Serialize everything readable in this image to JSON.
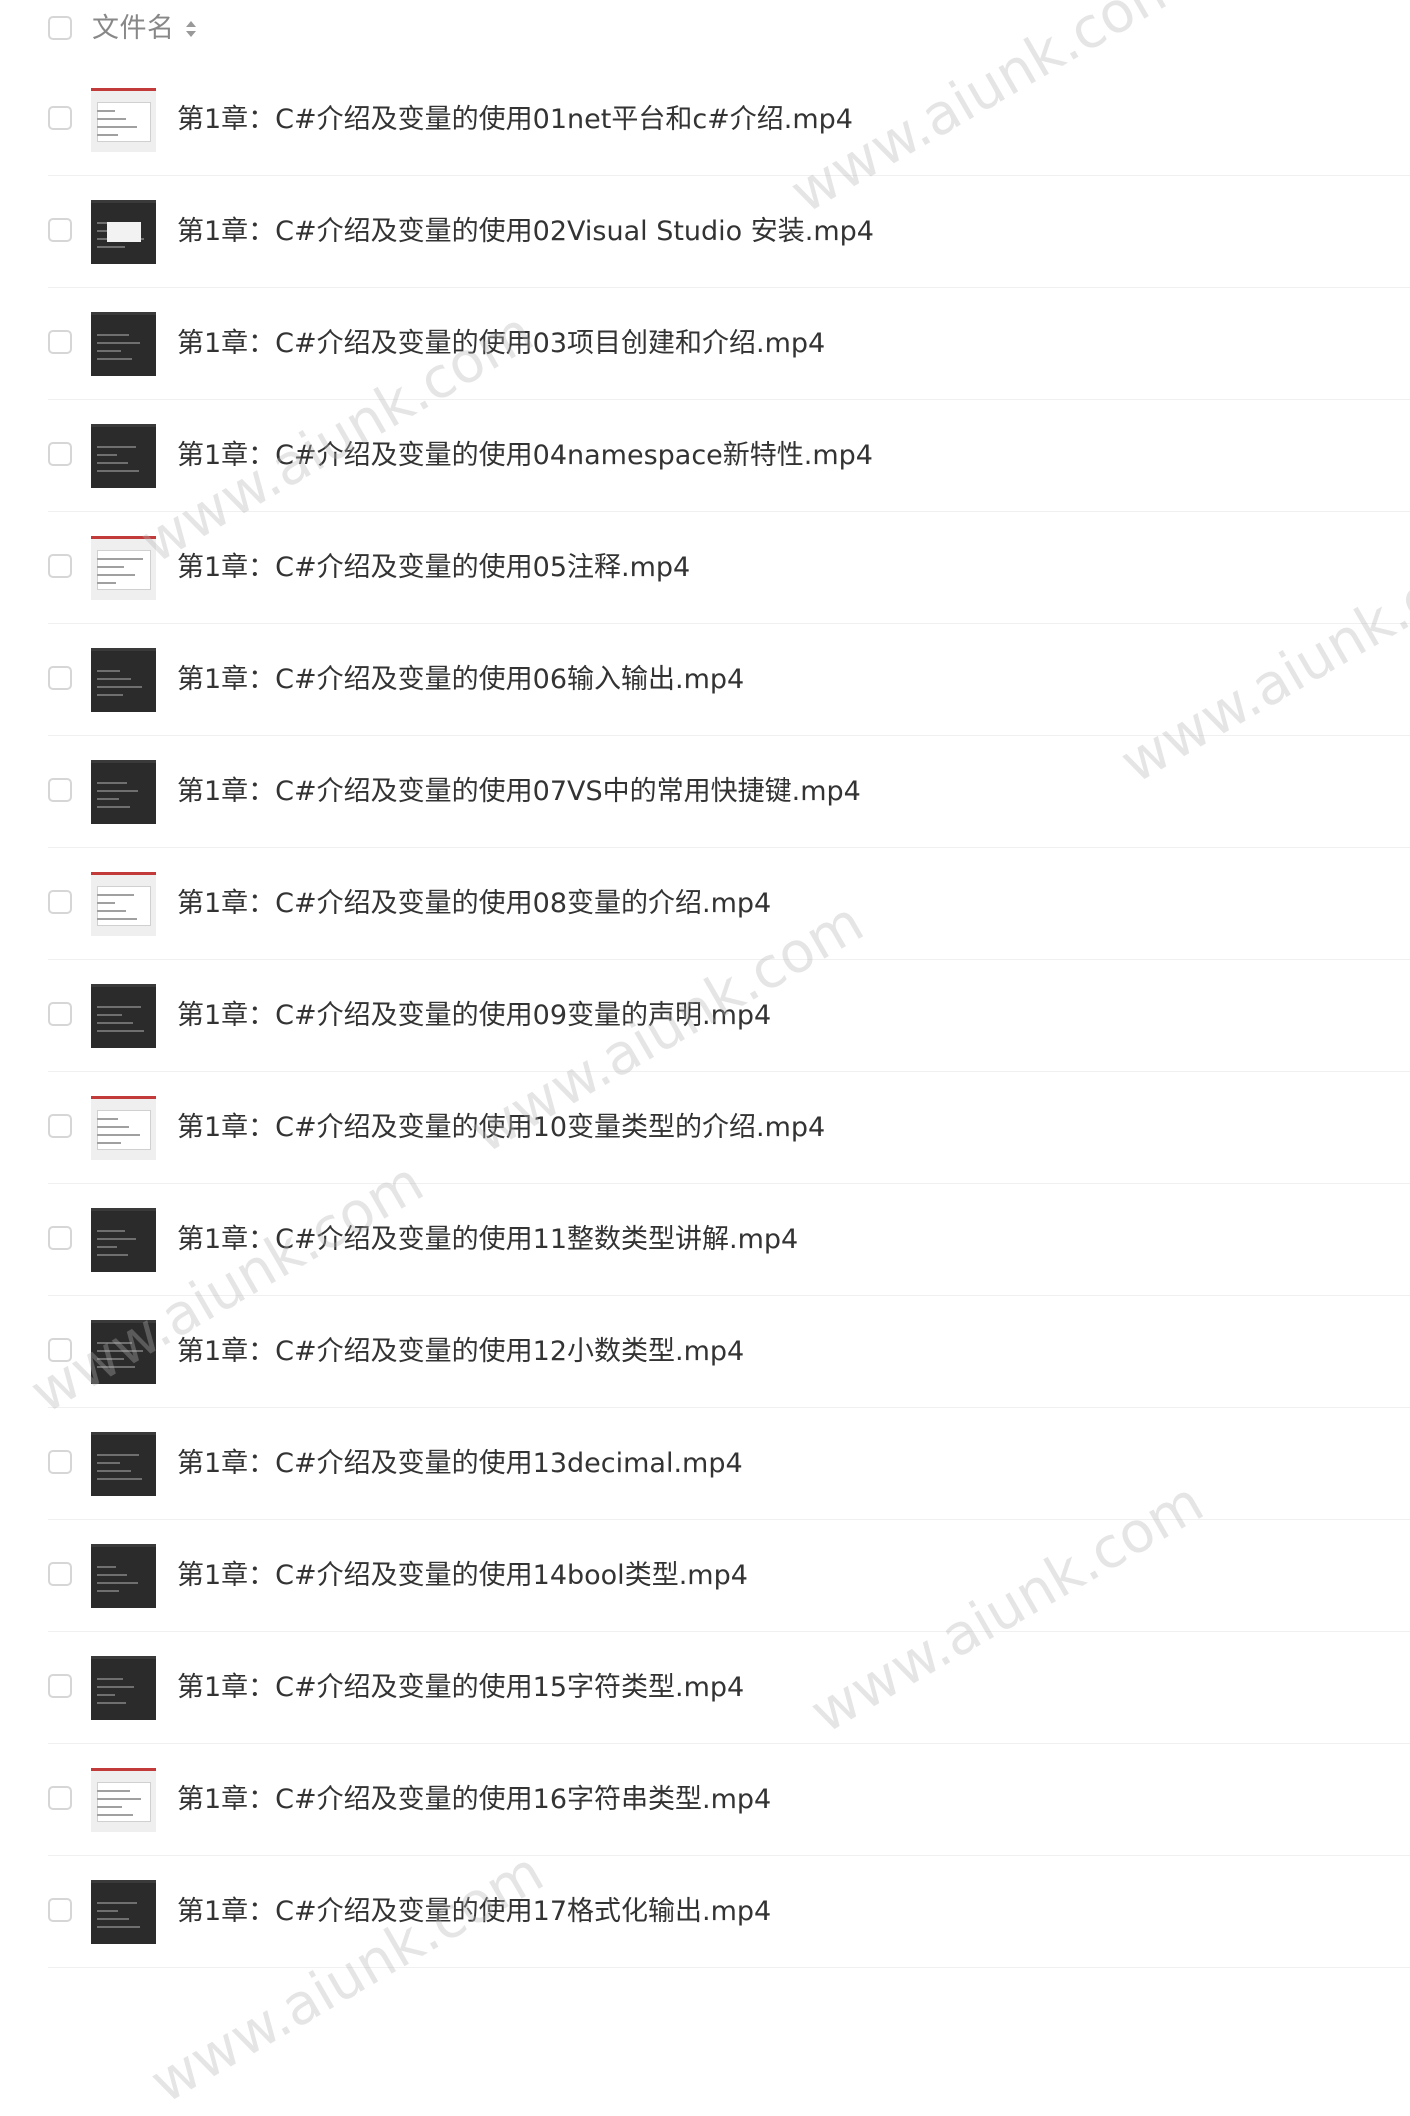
{
  "header": {
    "label": "文件名"
  },
  "files": [
    {
      "name": "第1章：C#介绍及变量的使用01net平台和c#介绍.mp4",
      "thumb": "light"
    },
    {
      "name": "第1章：C#介绍及变量的使用02Visual Studio 安装.mp4",
      "thumb": "dark"
    },
    {
      "name": "第1章：C#介绍及变量的使用03项目创建和介绍.mp4",
      "thumb": "dark"
    },
    {
      "name": "第1章：C#介绍及变量的使用04namespace新特性.mp4",
      "thumb": "dark"
    },
    {
      "name": "第1章：C#介绍及变量的使用05注释.mp4",
      "thumb": "light"
    },
    {
      "name": "第1章：C#介绍及变量的使用06输入输出.mp4",
      "thumb": "dark"
    },
    {
      "name": "第1章：C#介绍及变量的使用07VS中的常用快捷键.mp4",
      "thumb": "dark"
    },
    {
      "name": "第1章：C#介绍及变量的使用08变量的介绍.mp4",
      "thumb": "light"
    },
    {
      "name": "第1章：C#介绍及变量的使用09变量的声明.mp4",
      "thumb": "dark"
    },
    {
      "name": "第1章：C#介绍及变量的使用10变量类型的介绍.mp4",
      "thumb": "light"
    },
    {
      "name": "第1章：C#介绍及变量的使用11整数类型讲解.mp4",
      "thumb": "dark"
    },
    {
      "name": "第1章：C#介绍及变量的使用12小数类型.mp4",
      "thumb": "dark"
    },
    {
      "name": "第1章：C#介绍及变量的使用13decimal.mp4",
      "thumb": "dark"
    },
    {
      "name": "第1章：C#介绍及变量的使用14bool类型.mp4",
      "thumb": "dark"
    },
    {
      "name": "第1章：C#介绍及变量的使用15字符类型.mp4",
      "thumb": "dark"
    },
    {
      "name": "第1章：C#介绍及变量的使用16字符串类型.mp4",
      "thumb": "light"
    },
    {
      "name": "第1章：C#介绍及变量的使用17格式化输出.mp4",
      "thumb": "dark"
    }
  ],
  "watermark": "www.aiunk.com"
}
